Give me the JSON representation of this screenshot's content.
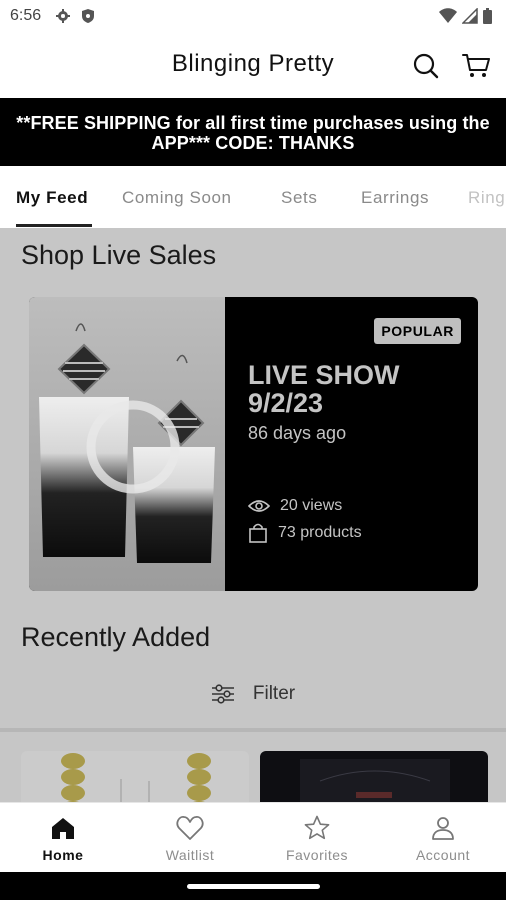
{
  "status_bar": {
    "time": "6:56"
  },
  "header": {
    "title": "Blinging Pretty"
  },
  "banner": {
    "text": "**FREE SHIPPING for all first time purchases using the APP*** CODE: THANKS"
  },
  "tabs": [
    {
      "label": "My Feed",
      "active": true
    },
    {
      "label": "Coming Soon"
    },
    {
      "label": "Sets"
    },
    {
      "label": "Earrings"
    },
    {
      "label": "Rings"
    }
  ],
  "live_sales": {
    "section_title": "Shop Live Sales",
    "card": {
      "badge": "POPULAR",
      "title": "LIVE SHOW 9/2/23",
      "ago": "86 days ago",
      "views": "20 views",
      "products": "73 products"
    }
  },
  "recently_added": {
    "section_title": "Recently Added",
    "filter_label": "Filter"
  },
  "bottom_nav": [
    {
      "label": "Home",
      "icon": "home-icon",
      "active": true
    },
    {
      "label": "Waitlist",
      "icon": "heart-icon"
    },
    {
      "label": "Favorites",
      "icon": "star-icon"
    },
    {
      "label": "Account",
      "icon": "person-icon"
    }
  ]
}
